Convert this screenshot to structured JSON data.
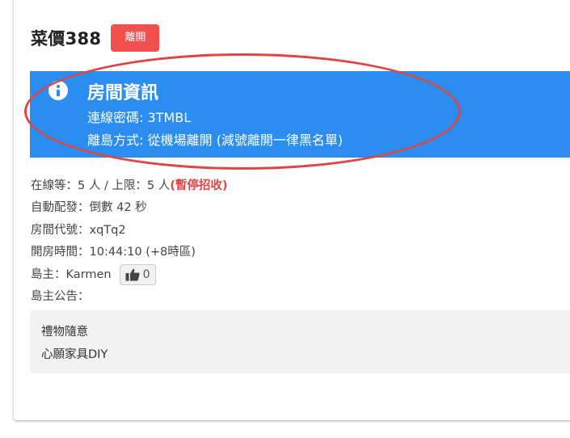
{
  "room": {
    "title": "菜價388",
    "leave_label": "離開"
  },
  "info_box": {
    "icon": "info-icon",
    "title": "房間資訊",
    "password_line": "連線密碼: 3TMBL",
    "exit_line": "離島方式: 從機場離開 (減號離開一律黑名單)"
  },
  "details": {
    "online": "在線等：5 人 / 上限：5 人",
    "paused": "(暫停招收)",
    "auto_dispatch": "自動配發：倒數 42 秒",
    "room_code": "房間代號：xqTq2",
    "open_time": "開房時間：10:44:10 (+8時區)",
    "host": "島主：Karmen",
    "likes": "0",
    "announcement_label": "島主公告："
  },
  "announcement": {
    "lines": [
      "禮物隨意",
      "心願家具DIY"
    ]
  },
  "colors": {
    "info_blue": "#2b8df0",
    "leave_red": "#f1504f",
    "paused_red": "#e04545",
    "highlight_red": "#e04545"
  }
}
